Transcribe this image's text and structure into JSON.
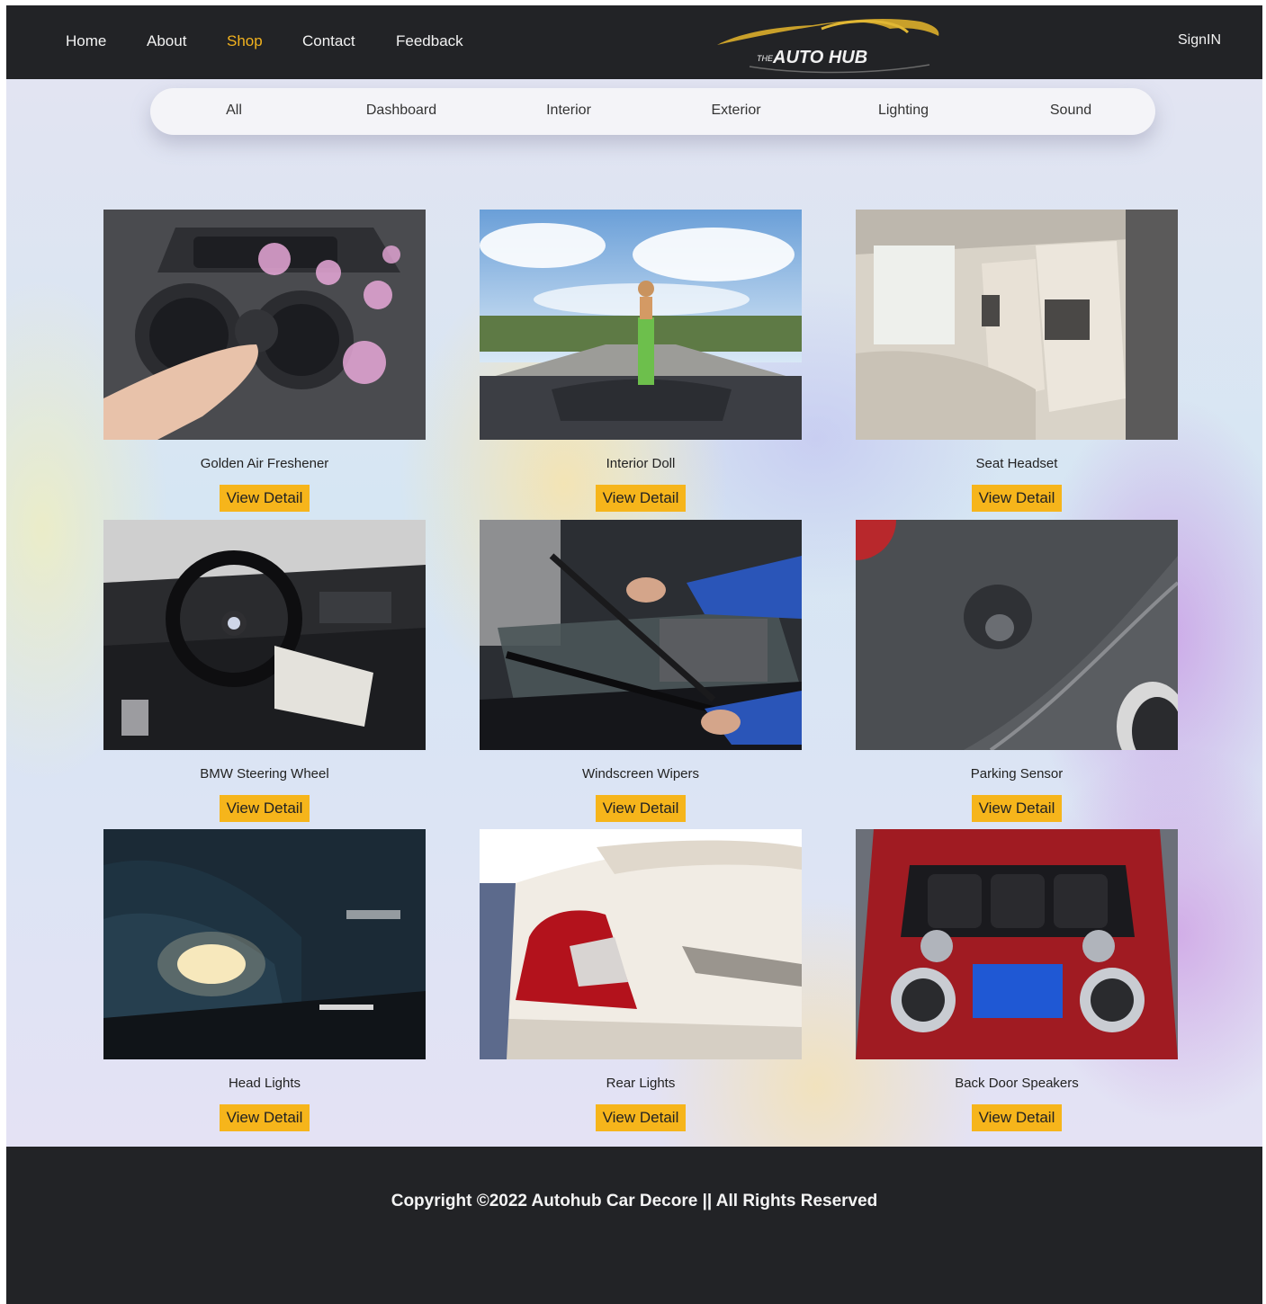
{
  "nav": {
    "links": [
      "Home",
      "About",
      "Shop",
      "Contact",
      "Feedback"
    ],
    "active": "Shop",
    "signin": "SignIN"
  },
  "logo": {
    "small": "THE",
    "text": "AUTO HUB"
  },
  "filters": [
    "All",
    "Dashboard",
    "Interior",
    "Exterior",
    "Lighting",
    "Sound"
  ],
  "products": [
    {
      "name": "Golden Air Freshener",
      "button": "View Detail"
    },
    {
      "name": "Interior Doll",
      "button": "View Detail"
    },
    {
      "name": "Seat Headset",
      "button": "View Detail"
    },
    {
      "name": "BMW Steering Wheel",
      "button": "View Detail"
    },
    {
      "name": "Windscreen Wipers",
      "button": "View Detail"
    },
    {
      "name": "Parking Sensor",
      "button": "View Detail"
    },
    {
      "name": "Head Lights",
      "button": "View Detail"
    },
    {
      "name": "Rear Lights",
      "button": "View Detail"
    },
    {
      "name": "Back Door Speakers",
      "button": "View Detail"
    }
  ],
  "footer": {
    "copyright": "Copyright ©2022 Autohub Car Decore || All Rights Reserved"
  },
  "colors": {
    "header": "#222326",
    "accent": "#f2b21e",
    "button": "#f6b51b"
  }
}
